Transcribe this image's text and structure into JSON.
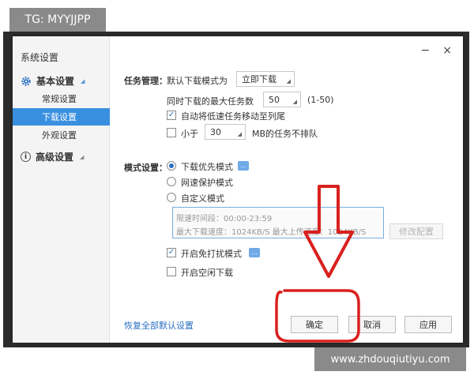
{
  "overlay_tag": "TG: MYYJJPP",
  "watermark": "www.zhdouqiutiyu.com",
  "window": {
    "title": "系统设置",
    "minimize": "−",
    "close": "×"
  },
  "sidebar": {
    "basic_group": "基本设置",
    "items": [
      {
        "label": "常规设置"
      },
      {
        "label": "下载设置"
      },
      {
        "label": "外观设置"
      }
    ],
    "advanced_group": "高级设置"
  },
  "task": {
    "section_label": "任务管理：",
    "default_mode_label": "默认下载模式为",
    "default_mode_value": "立即下载",
    "max_tasks_label": "同时下载的最大任务数",
    "max_tasks_value": "50",
    "max_tasks_range": "(1-50)",
    "auto_move_label": "自动将低速任务移动至列尾",
    "auto_move_checked": true,
    "less_than_label": "小于",
    "less_than_value": "30",
    "less_than_suffix": "MB的任务不排队",
    "less_than_checked": false
  },
  "mode": {
    "section_label": "模式设置：",
    "options": [
      {
        "label": "下载优先模式",
        "checked": true
      },
      {
        "label": "网速保护模式",
        "checked": false
      },
      {
        "label": "自定义模式",
        "checked": false
      }
    ],
    "schedule_time": "限速时间段：00:00-23:59",
    "schedule_speed": "最大下载速度：1024KB/S   最大上传速度：1024KB/S",
    "modify_button": "修改配置"
  },
  "no_disturb_label": "开启免打扰模式",
  "no_disturb_checked": true,
  "idle_download_label": "开启空闲下载",
  "idle_download_checked": false,
  "footer": {
    "restore_link": "恢复全部默认设置",
    "ok": "确定",
    "cancel": "取消",
    "apply": "应用"
  },
  "colors": {
    "accent": "#3a90e0",
    "annotation_red": "#d9211e"
  }
}
